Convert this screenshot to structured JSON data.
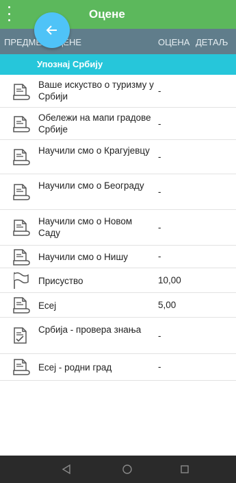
{
  "header": {
    "title": "Оцене",
    "menu_icon": "more-vert-icon",
    "back_icon": "arrow-left-icon"
  },
  "columns": {
    "subject": "ПРЕДМЕТ ОЦЕНЕ",
    "grade": "ОЦЕНА",
    "details": "ДЕТАЉ"
  },
  "section": {
    "title": "Упознај Србију"
  },
  "rows": [
    {
      "name": "Ваше искуство о туризму у Србији",
      "grade": "-",
      "icon": "assignment-icon"
    },
    {
      "name": "Обележи на мапи градове Србије",
      "grade": "-",
      "icon": "assignment-icon"
    },
    {
      "name": "Научили смо о Крагујевцу",
      "grade": "-",
      "icon": "assignment-icon"
    },
    {
      "name": "Научили смо о Београду",
      "grade": "-",
      "icon": "assignment-icon"
    },
    {
      "name": "Научили смо о Новом Саду",
      "grade": "-",
      "icon": "assignment-icon"
    },
    {
      "name": "Научили смо о Нишу",
      "grade": "-",
      "icon": "assignment-icon"
    },
    {
      "name": "Присуство",
      "grade": "10,00",
      "icon": "attendance-flag-icon"
    },
    {
      "name": "Есеј",
      "grade": "5,00",
      "icon": "assignment-icon"
    },
    {
      "name": "Србија - провера знања",
      "grade": "-",
      "icon": "quiz-icon"
    },
    {
      "name": "Есеј - родни град",
      "grade": "-",
      "icon": "assignment-icon"
    }
  ],
  "navbar": {
    "back_icon": "nav-back-icon",
    "home_icon": "nav-home-icon",
    "recents_icon": "nav-recents-icon"
  },
  "colors": {
    "toolbar": "#5cb85c",
    "fab": "#4fc3f7",
    "column_header": "#607d8b",
    "section": "#26c6da",
    "navbar": "#2a2a2a"
  }
}
